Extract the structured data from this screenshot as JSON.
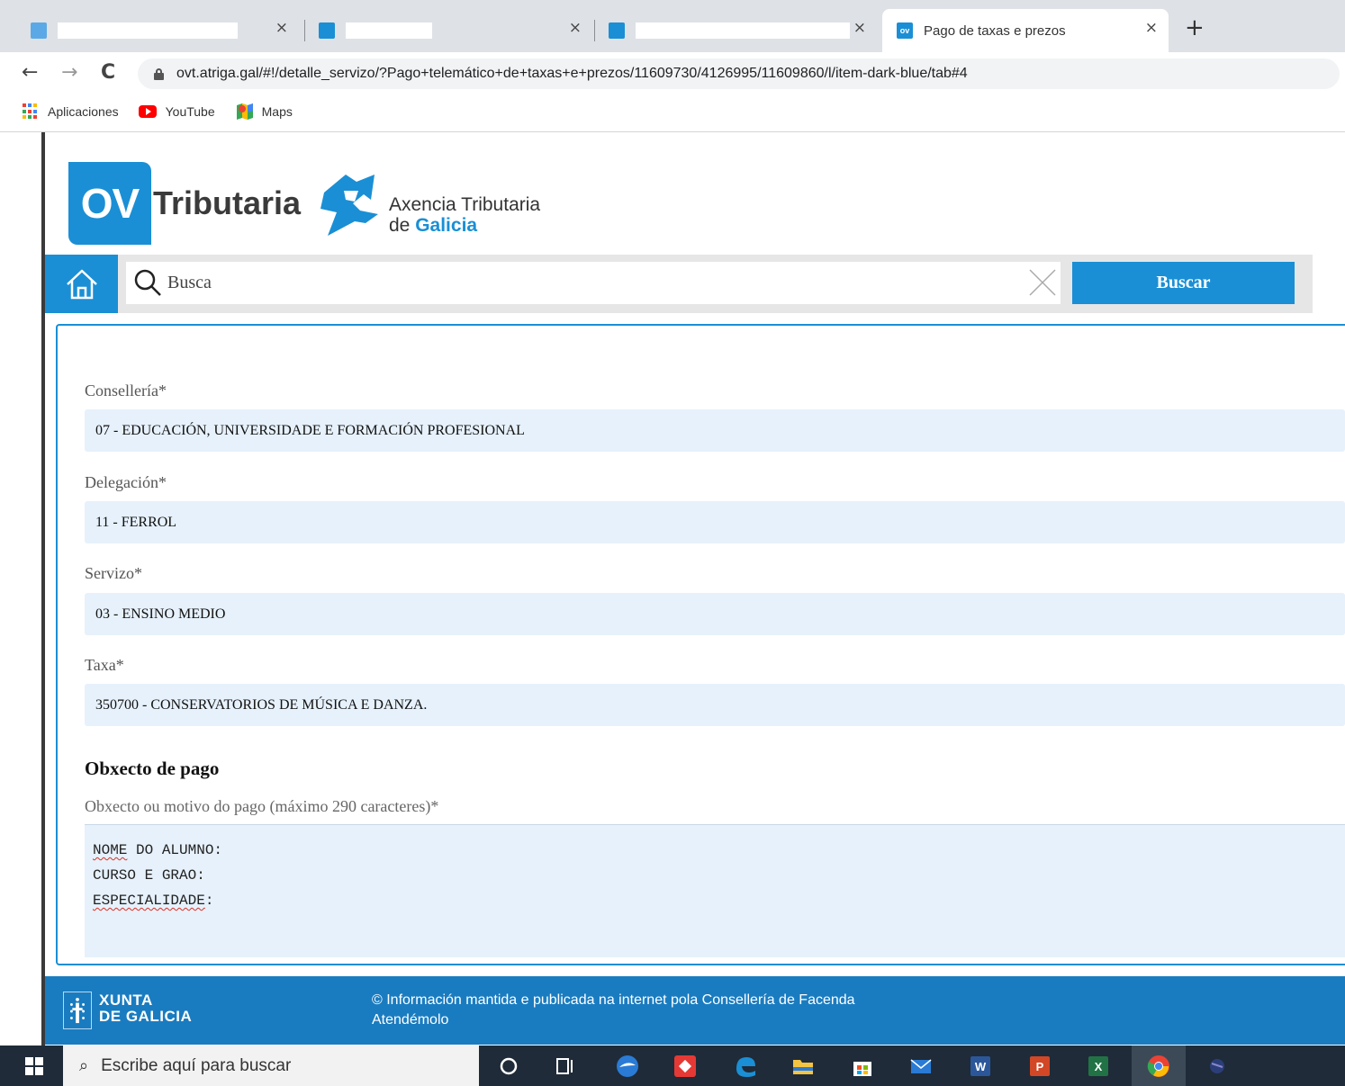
{
  "browser": {
    "tabs": [
      {
        "title": "",
        "close": "×",
        "favicon_color": "#1a8fd5"
      },
      {
        "title": "",
        "close": "×",
        "favicon_color": "#1a8fd5"
      },
      {
        "title": "",
        "close": "×",
        "favicon_color": "#1a8fd5"
      },
      {
        "title": "Pago de taxas e prezos",
        "close": "×",
        "favicon_color": "#1a8fd5",
        "favicon_text": "ov"
      }
    ],
    "new_tab": "+",
    "nav": {
      "back": "←",
      "forward": "→",
      "reload": "C"
    },
    "url": "ovt.atriga.gal/#!/detalle_servizo/?Pago+telemático+de+taxas+e+prezos/11609730/4126995/11609860/l/item-dark-blue/tab#4",
    "bookmarks": [
      {
        "label": "Aplicaciones",
        "icon": "apps-grid-icon"
      },
      {
        "label": "YouTube",
        "icon": "youtube-icon"
      },
      {
        "label": "Maps",
        "icon": "maps-icon"
      }
    ]
  },
  "header": {
    "logo_ov": "OV",
    "logo_tributaria": "Tributaria",
    "agency_line1": "Axencia Tributaria",
    "agency_line2_prefix": "de ",
    "agency_line2_bold": "Galicia"
  },
  "search": {
    "placeholder": "Busca",
    "value": "",
    "button": "Buscar"
  },
  "form": {
    "fields": [
      {
        "label": "Consellería*",
        "value": "07 - EDUCACIÓN, UNIVERSIDADE E FORMACIÓN PROFESIONAL"
      },
      {
        "label": "Delegación*",
        "value": "11 - FERROL"
      },
      {
        "label": "Servizo*",
        "value": "03 - ENSINO MEDIO"
      },
      {
        "label": "Taxa*",
        "value": "350700 - CONSERVATORIOS DE MÚSICA E DANZA."
      }
    ],
    "section_title": "Obxecto de pago",
    "textarea_label": "Obxecto ou motivo do pago (máximo 290 caracteres)*",
    "textarea_lines": [
      {
        "pre": "",
        "squiggly": "NOME",
        "post": " DO ALUMNO:"
      },
      {
        "pre": "CURSO E GRAO:",
        "squiggly": "",
        "post": ""
      },
      {
        "pre": "",
        "squiggly": "ESPECIALIDADE",
        "post": ":"
      }
    ]
  },
  "footer": {
    "xunta_line1": "XUNTA",
    "xunta_line2": "DE GALICIA",
    "line1": "© Información mantida e publicada na internet pola Consellería de Facenda",
    "line2": "Atendémolo"
  },
  "taskbar": {
    "search_placeholder": "Escribe aquí para buscar",
    "colors": {
      "background": "#1f2b38",
      "accent": "#1a8fd5"
    }
  }
}
